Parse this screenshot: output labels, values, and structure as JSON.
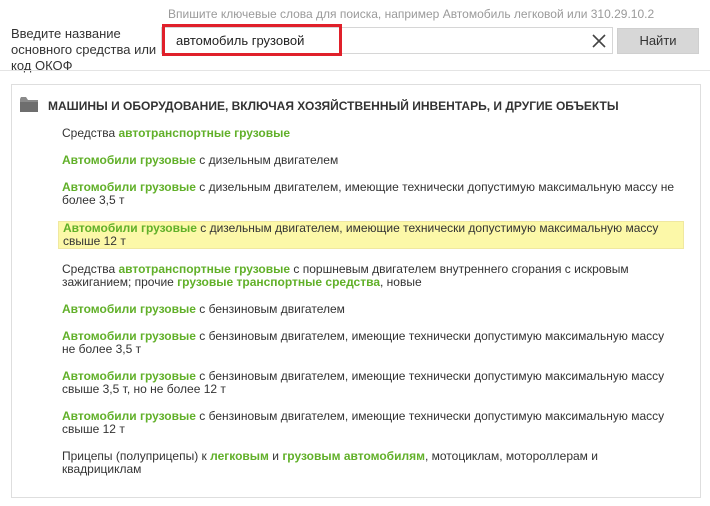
{
  "search": {
    "hint": "Впишите ключевые слова для поиска, например Автомобиль легковой или 310.29.10.2",
    "side_label": "Введите название основного средства или код ОКОФ",
    "query": "автомобиль грузовой",
    "button_label": "Найти",
    "clear_icon": "close-icon"
  },
  "category": {
    "icon": "folder-icon",
    "title": "МАШИНЫ И ОБОРУДОВАНИЕ, ВКЛЮЧАЯ ХОЗЯЙСТВЕННЫЙ ИНВЕНТАРЬ, И ДРУГИЕ ОБЪЕКТЫ"
  },
  "results": [
    {
      "selected": false,
      "segments": [
        {
          "t": "Средства ",
          "kw": false
        },
        {
          "t": "автотранспортные грузовые",
          "kw": true
        }
      ]
    },
    {
      "selected": false,
      "segments": [
        {
          "t": "Автомобили грузовые",
          "kw": true
        },
        {
          "t": " с дизельным двигателем",
          "kw": false
        }
      ]
    },
    {
      "selected": false,
      "segments": [
        {
          "t": "Автомобили грузовые",
          "kw": true
        },
        {
          "t": " с дизельным двигателем, имеющие технически допустимую максимальную массу не более 3,5 т",
          "kw": false
        }
      ]
    },
    {
      "selected": true,
      "segments": [
        {
          "t": "Автомобили грузовые",
          "kw": true
        },
        {
          "t": " с дизельным двигателем, имеющие технически допустимую максимальную массу свыше 12 т",
          "kw": false
        }
      ]
    },
    {
      "selected": false,
      "segments": [
        {
          "t": "Средства ",
          "kw": false
        },
        {
          "t": "автотранспортные грузовые",
          "kw": true
        },
        {
          "t": " с поршневым двигателем внутреннего сгорания с искровым зажиганием; прочие ",
          "kw": false
        },
        {
          "t": "грузовые транспортные средства",
          "kw": true
        },
        {
          "t": ", новые",
          "kw": false
        }
      ]
    },
    {
      "selected": false,
      "segments": [
        {
          "t": "Автомобили грузовые",
          "kw": true
        },
        {
          "t": " с бензиновым двигателем",
          "kw": false
        }
      ]
    },
    {
      "selected": false,
      "segments": [
        {
          "t": "Автомобили грузовые",
          "kw": true
        },
        {
          "t": " с бензиновым двигателем, имеющие технически допустимую максимальную массу не более 3,5 т",
          "kw": false
        }
      ]
    },
    {
      "selected": false,
      "segments": [
        {
          "t": "Автомобили грузовые",
          "kw": true
        },
        {
          "t": " с бензиновым двигателем, имеющие технически допустимую максимальную массу свыше 3,5 т, но не более 12 т",
          "kw": false
        }
      ]
    },
    {
      "selected": false,
      "segments": [
        {
          "t": "Автомобили грузовые",
          "kw": true
        },
        {
          "t": " с бензиновым двигателем, имеющие технически допустимую максимальную массу свыше 12 т",
          "kw": false
        }
      ]
    },
    {
      "selected": false,
      "segments": [
        {
          "t": "Прицепы (полуприцепы) к ",
          "kw": false
        },
        {
          "t": "легковым",
          "kw": true
        },
        {
          "t": " и ",
          "kw": false
        },
        {
          "t": "грузовым автомобилям",
          "kw": true
        },
        {
          "t": ", мотоциклам, мотороллерам и квадрициклам",
          "kw": false
        }
      ]
    }
  ],
  "colors": {
    "keyword": "#61b029",
    "highlight_frame": "#e0202a",
    "selected_bg": "#fcf8a8"
  }
}
